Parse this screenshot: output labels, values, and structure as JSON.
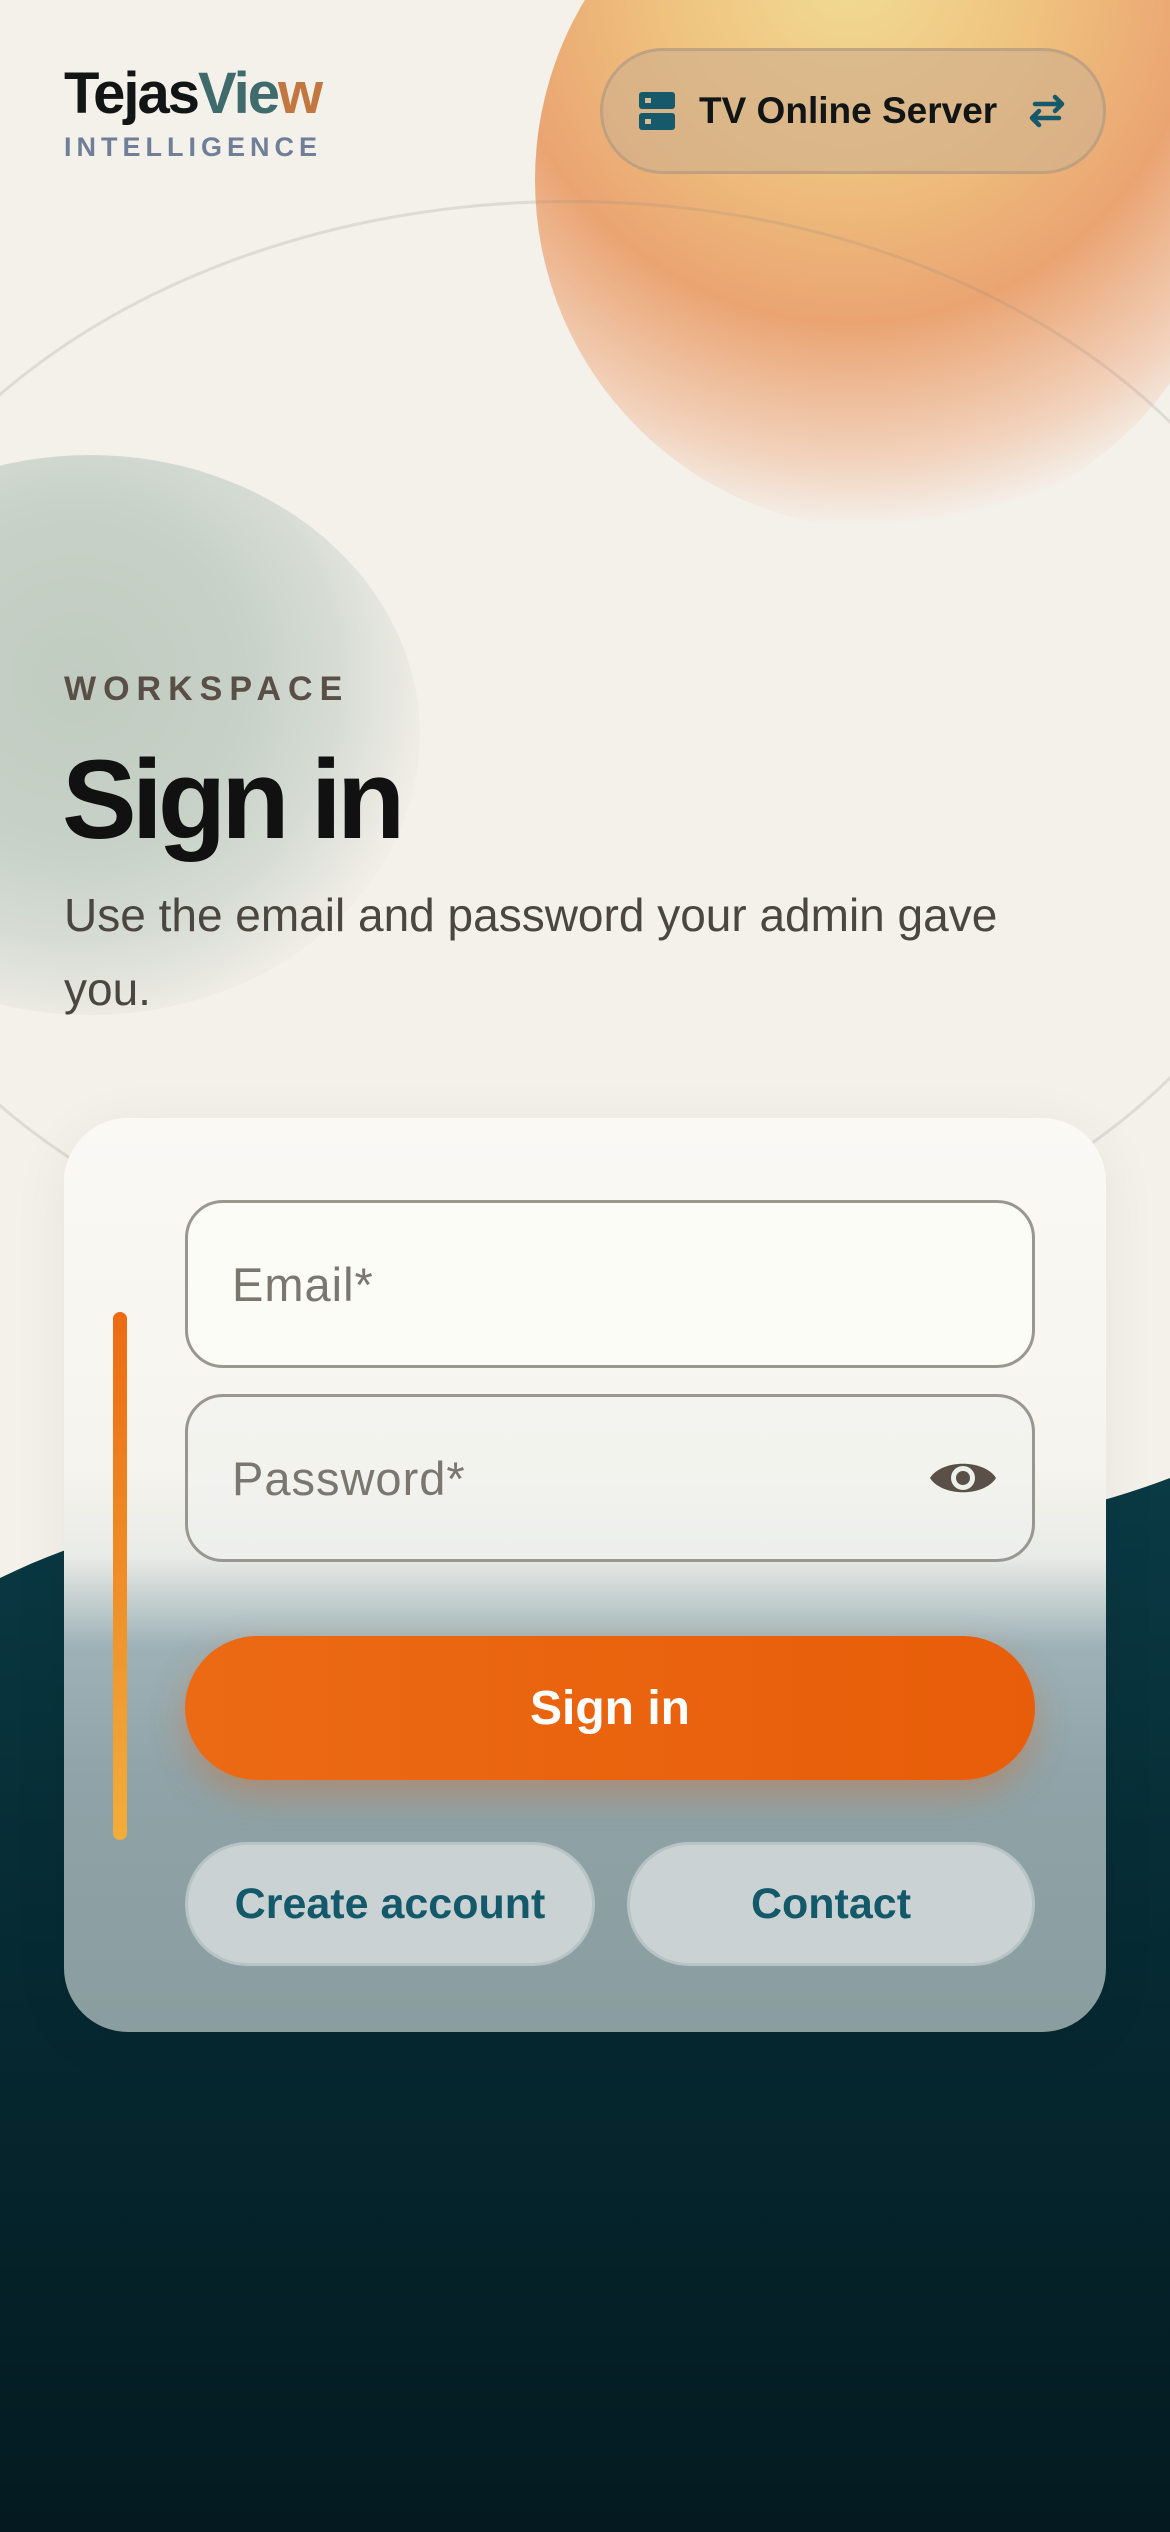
{
  "brand": {
    "name_part1": "Tejas",
    "name_part2": "Vie",
    "name_part3": "w",
    "tagline": "INTELLIGENCE"
  },
  "server": {
    "label": "TV Online Server",
    "icon": "server-icon",
    "switch_icon": "swap-arrows-icon"
  },
  "heading": {
    "eyebrow": "WORKSPACE",
    "title": "Sign in",
    "subtitle": "Use the email and password your admin gave you."
  },
  "form": {
    "email_placeholder": "Email*",
    "email_value": "",
    "password_placeholder": "Password*",
    "password_value": "",
    "show_password_icon": "eye-icon",
    "submit_label": "Sign in",
    "create_account_label": "Create account",
    "contact_label": "Contact"
  },
  "colors": {
    "accent": "#e9620e",
    "brand_teal": "#13596a",
    "dark_background": "#062a33"
  }
}
